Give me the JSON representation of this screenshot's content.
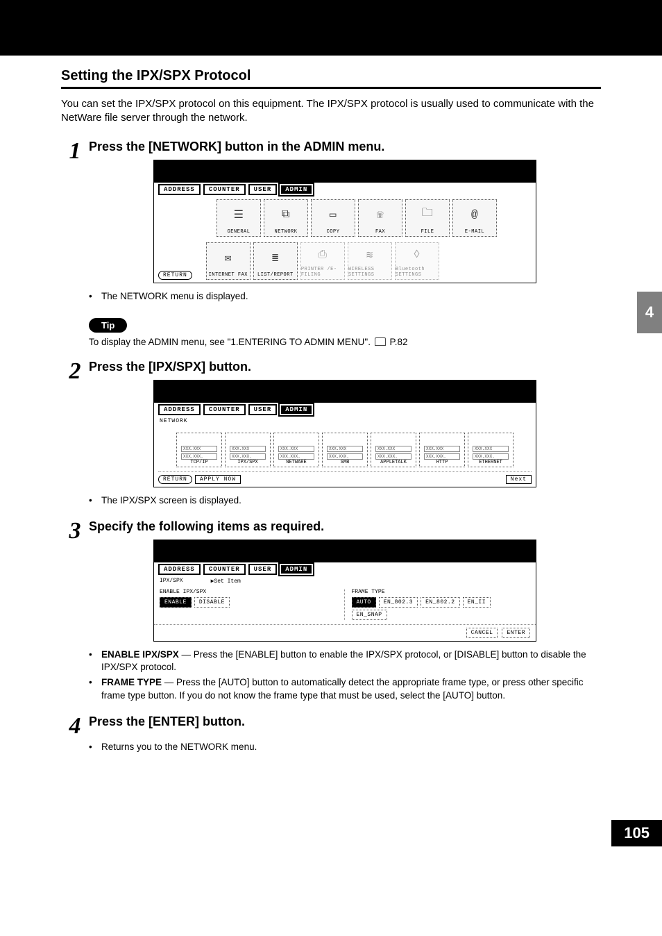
{
  "header": {
    "title": "Setting the IPX/SPX Protocol",
    "intro": "You can set the IPX/SPX protocol on this equipment.  The IPX/SPX protocol is usually used to communicate with the NetWare file server through the network."
  },
  "chapter_tab": "4",
  "page_number": "105",
  "tip": {
    "label": "Tip",
    "text_before": "To display the ADMIN menu, see \"1.ENTERING TO ADMIN MENU\".  ",
    "ref": "P.82"
  },
  "steps": {
    "s1": {
      "num": "1",
      "title": "Press the [NETWORK] button in the ADMIN menu.",
      "note": "The NETWORK menu is displayed."
    },
    "s2": {
      "num": "2",
      "title": "Press the [IPX/SPX] button.",
      "note": "The IPX/SPX screen is displayed."
    },
    "s3": {
      "num": "3",
      "title": "Specify the following items as required.",
      "b1_label": "ENABLE IPX/SPX",
      "b1_text": " — Press the [ENABLE] button to enable the IPX/SPX protocol, or [DISABLE] button to disable the IPX/SPX protocol.",
      "b2_label": "FRAME TYPE",
      "b2_text": " — Press the [AUTO] button to automatically detect the appropriate frame type, or press other specific frame type button.  If you do not know the frame type that must be used, select the [AUTO] button."
    },
    "s4": {
      "num": "4",
      "title": "Press the [ENTER] button.",
      "note": "Returns you to the NETWORK menu."
    }
  },
  "panel_common": {
    "tabs": {
      "address": "ADDRESS",
      "counter": "COUNTER",
      "user": "USER",
      "admin": "ADMIN"
    },
    "return": "RETURN"
  },
  "panel1": {
    "row1": {
      "general": "GENERAL",
      "network": "NETWORK",
      "copy": "COPY",
      "fax": "FAX",
      "file": "FILE",
      "email": "E-MAIL"
    },
    "row2": {
      "ifax": "INTERNET FAX",
      "list": "LIST/REPORT",
      "printer": "PRINTER /E-FILING",
      "wireless": "WIRELESS SETTINGS",
      "bluetooth": "Bluetooth SETTINGS"
    }
  },
  "panel2": {
    "breadcrumb": "NETWORK",
    "placeholder1": "XXX.XXX",
    "placeholder2": "XXX.XXX.",
    "protos": {
      "tcpip": "TCP/IP",
      "ipxspx": "IPX/SPX",
      "netware": "NETWARE",
      "smb": "SMB",
      "appletalk": "APPLETALK",
      "http": "HTTP",
      "ethernet": "ETHERNET"
    },
    "apply": "APPLY NOW",
    "next": "Next"
  },
  "panel3": {
    "breadcrumb": "IPX/SPX",
    "set_item": "▶Set Item",
    "enable_label": "ENABLE IPX/SPX",
    "enable": "ENABLE",
    "disable": "DISABLE",
    "frame_label": "FRAME TYPE",
    "frame": {
      "auto": "AUTO",
      "en8023": "EN_802.3",
      "en8022": "EN_802.2",
      "enii": "EN_II",
      "ensnap": "EN_SNAP"
    },
    "cancel": "CANCEL",
    "enter": "ENTER"
  }
}
